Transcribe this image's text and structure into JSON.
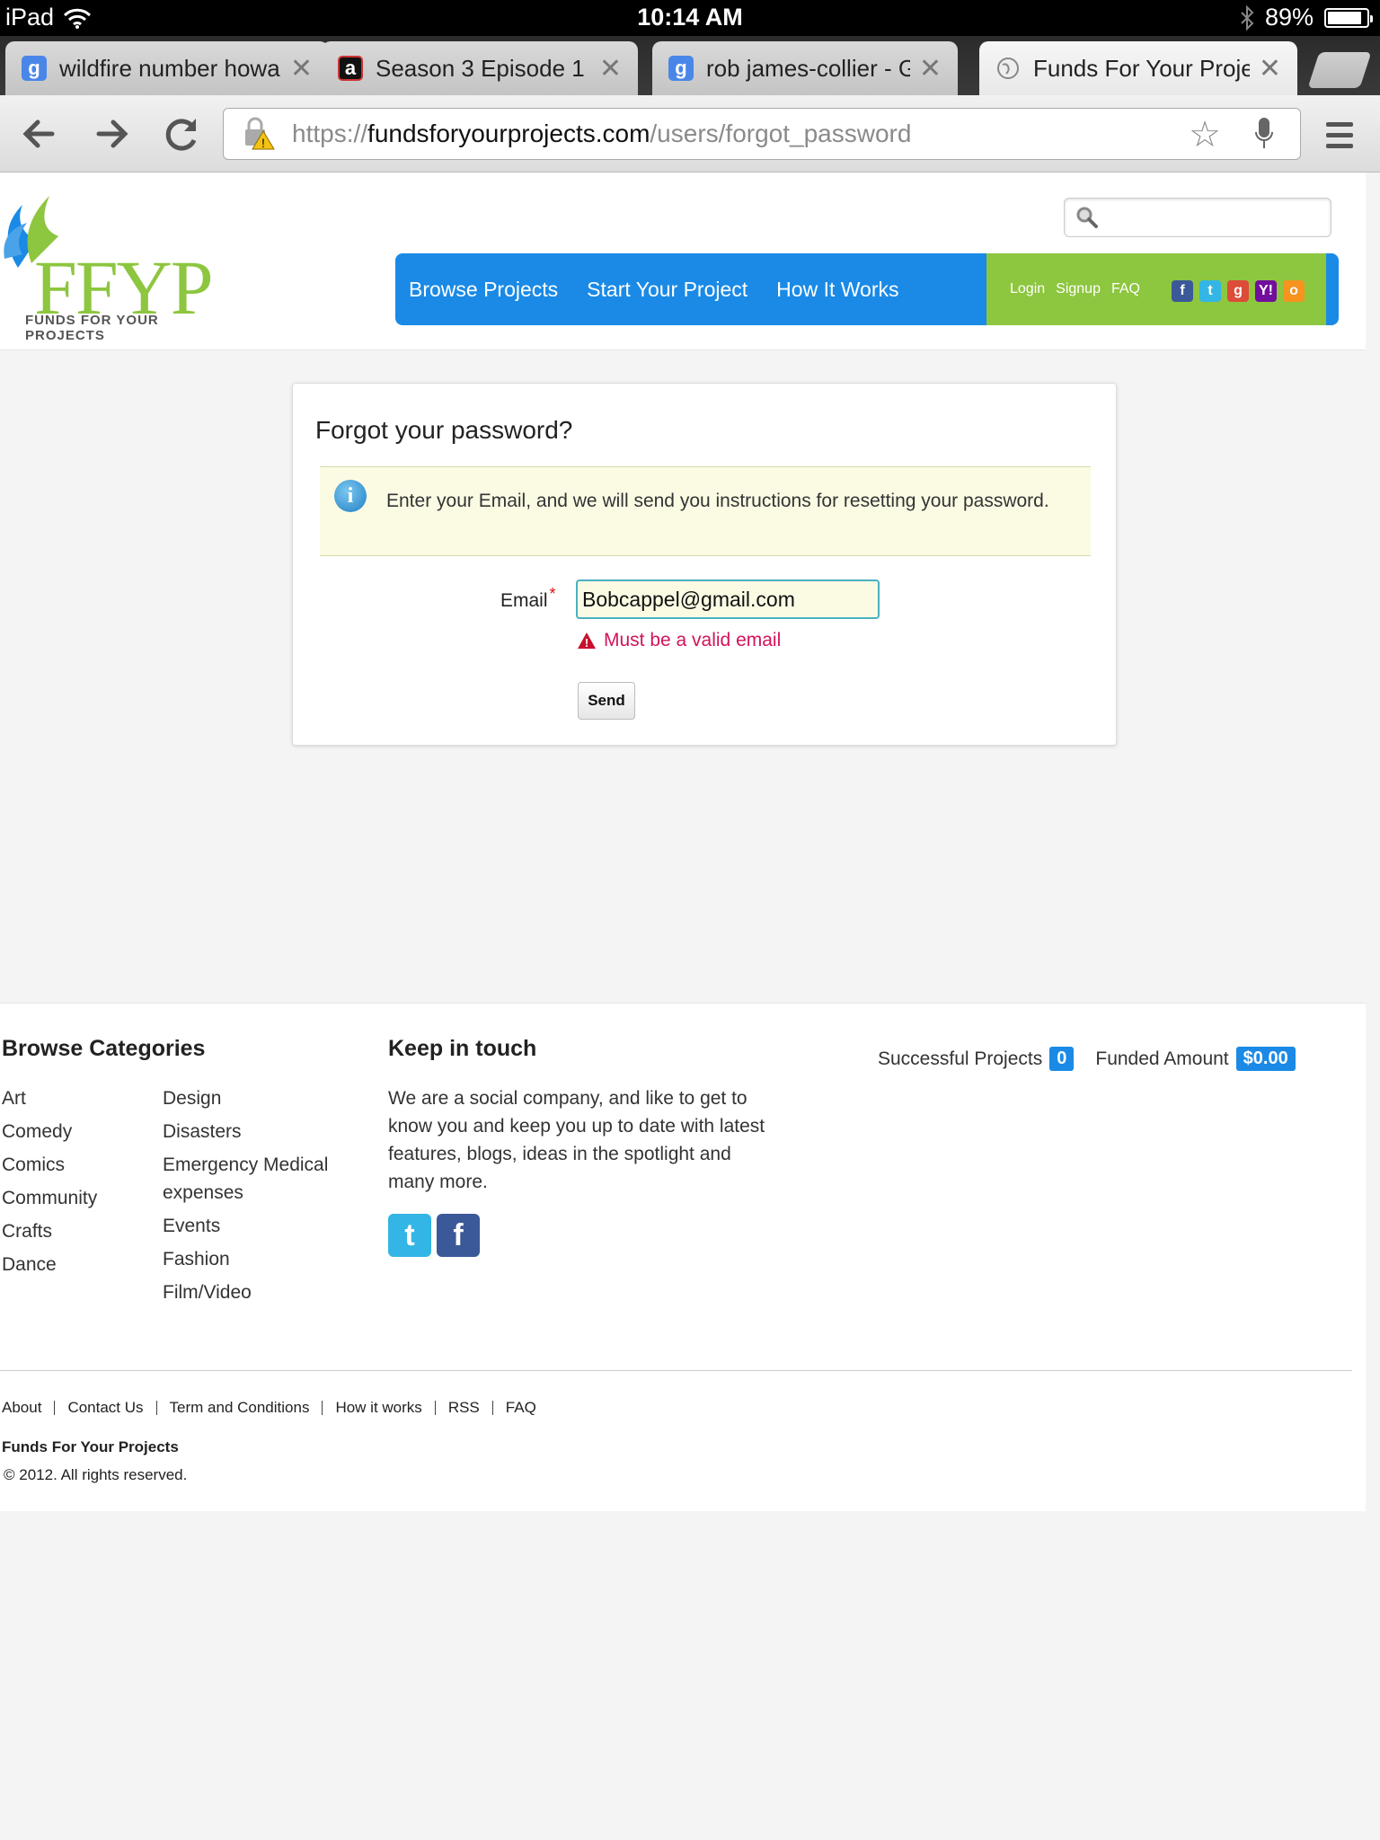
{
  "status_bar": {
    "device": "iPad",
    "time": "10:14 AM",
    "battery_text": "89%",
    "battery_level": 0.89,
    "icons": [
      "wifi-icon",
      "bluetooth-icon",
      "battery-icon"
    ]
  },
  "browser": {
    "tabs": [
      {
        "title": "wildfire number howar",
        "favicon": "google-icon",
        "favicon_letter": "g",
        "active": false
      },
      {
        "title": "Season 3 Episode 1",
        "favicon": "amc-icon",
        "favicon_letter": "a",
        "active": false
      },
      {
        "title": "rob james-collier - Go",
        "favicon": "google-icon",
        "favicon_letter": "g",
        "active": false
      },
      {
        "title": "Funds For Your Projec",
        "favicon": "globe-icon",
        "favicon_letter": "",
        "active": true
      }
    ],
    "url": {
      "scheme": "https://",
      "host": "fundsforyourprojects.com",
      "path": "/users/forgot_password"
    }
  },
  "site": {
    "logo_text": "FFYP",
    "logo_subtitle": "FUNDS FOR YOUR PROJECTS",
    "nav": {
      "browse": "Browse Projects",
      "start": "Start Your Project",
      "how": "How It Works",
      "login": "Login",
      "signup": "Signup",
      "faq": "FAQ"
    },
    "social_icons": [
      "facebook-icon",
      "twitter-icon",
      "google-icon",
      "yahoo-icon",
      "openid-icon"
    ],
    "brand_colors": {
      "blue": "#1a8ae6",
      "green": "#8dc63f"
    }
  },
  "form": {
    "title": "Forgot your password?",
    "info": "Enter your Email, and we will send you instructions for resetting your password.",
    "email_label": "Email",
    "required_mark": "*",
    "email_value": "Bobcappel@gmail.com",
    "error": "Must be a valid email",
    "send_label": "Send"
  },
  "footer": {
    "categories_title": "Browse Categories",
    "categories_col1": [
      "Art",
      "Comedy",
      "Comics",
      "Community",
      "Crafts",
      "Dance"
    ],
    "categories_col2": [
      "Design",
      "Disasters",
      "Emergency Medical expenses",
      "Events",
      "Fashion",
      "Film/Video"
    ],
    "keep_title": "Keep in touch",
    "keep_text": "We are a social company, and like to get to know you and keep you up to date with latest features, blogs, ideas in the spotlight and many more.",
    "stats": {
      "successful_label": "Successful Projects",
      "successful_value": "0",
      "funded_label": "Funded Amount",
      "funded_value": "$0.00"
    },
    "links": [
      "About",
      "Contact Us",
      "Term and Conditions",
      "How it works",
      "RSS",
      "FAQ"
    ],
    "company": "Funds For Your Projects",
    "copyright": "© 2012. All rights reserved."
  }
}
